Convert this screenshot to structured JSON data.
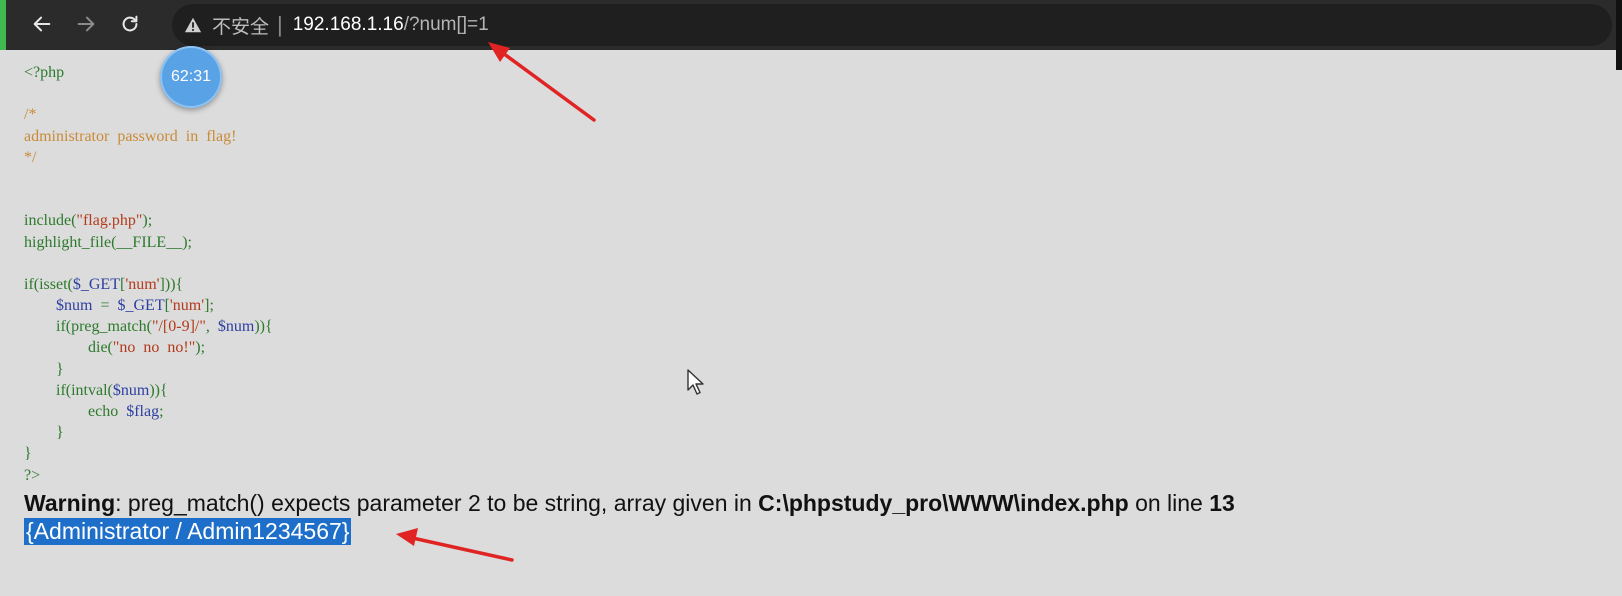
{
  "browser": {
    "security_label": "不安全",
    "separator": "|",
    "url_host": "192.168.1.16",
    "url_path": "/?num[]=1"
  },
  "overlay": {
    "timer": "62:31"
  },
  "source": {
    "lines": [
      {
        "kind": "kw",
        "text": "<?php"
      },
      {
        "kind": "blank",
        "text": ""
      },
      {
        "kind": "comment",
        "text": "/*"
      },
      {
        "kind": "comment",
        "text": "administrator  password  in  flag!"
      },
      {
        "kind": "comment",
        "text": "*/"
      },
      {
        "kind": "blank",
        "text": ""
      },
      {
        "kind": "blank",
        "text": ""
      },
      {
        "kind": "code",
        "text": "include(\"flag.php\");"
      },
      {
        "kind": "code",
        "text": "highlight_file(__FILE__);"
      },
      {
        "kind": "blank",
        "text": ""
      },
      {
        "kind": "code",
        "text": "if(isset($_GET['num'])){"
      },
      {
        "kind": "code",
        "text": "        $num  =  $_GET['num'];"
      },
      {
        "kind": "code",
        "text": "        if(preg_match(\"/[0-9]/\",  $num)){"
      },
      {
        "kind": "code",
        "text": "                die(\"no  no  no!\");"
      },
      {
        "kind": "code",
        "text": "        }"
      },
      {
        "kind": "code",
        "text": "        if(intval($num)){"
      },
      {
        "kind": "code",
        "text": "                echo  $flag;"
      },
      {
        "kind": "code",
        "text": "        }"
      },
      {
        "kind": "code",
        "text": "}"
      },
      {
        "kind": "code",
        "text": "?>"
      }
    ]
  },
  "warning": {
    "label": "Warning",
    "message": ": preg_match() expects parameter 2 to be string, array given in ",
    "file": "C:\\phpstudy_pro\\WWW\\index.php",
    "on_line": " on line ",
    "line_number": "13"
  },
  "flag_output": "{Administrator / Admin1234567}",
  "colors": {
    "annotation_arrow": "#e02424",
    "selection": "#1e6fc9",
    "page_background": "#dcdcdc"
  }
}
